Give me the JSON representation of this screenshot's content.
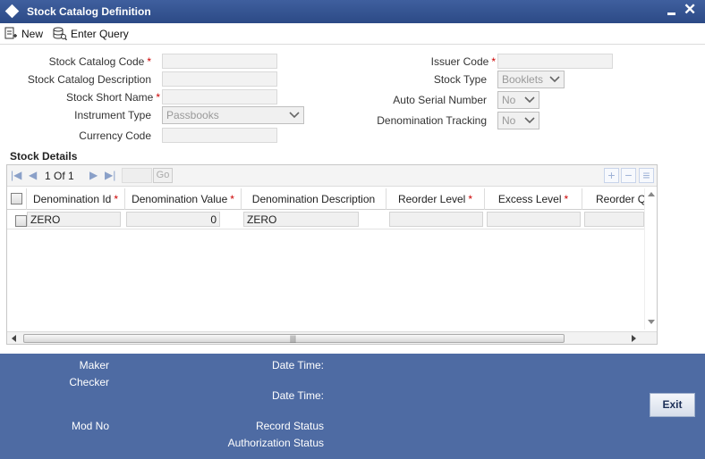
{
  "window": {
    "title": "Stock Catalog Definition"
  },
  "toolbar": {
    "new_label": "New",
    "enter_query_label": "Enter Query"
  },
  "form": {
    "stock_catalog_code_label": "Stock Catalog Code",
    "stock_catalog_description_label": "Stock Catalog Description",
    "stock_short_name_label": "Stock Short Name",
    "instrument_type_label": "Instrument Type",
    "instrument_type_value": "Passbooks",
    "currency_code_label": "Currency Code",
    "issuer_code_label": "Issuer Code",
    "stock_type_label": "Stock Type",
    "stock_type_value": "Booklets",
    "auto_serial_number_label": "Auto Serial Number",
    "auto_serial_number_value": "No",
    "denomination_tracking_label": "Denomination Tracking",
    "denomination_tracking_value": "No",
    "required_mark": "*"
  },
  "stock_details": {
    "title": "Stock Details",
    "pager": {
      "page_text": "1 Of 1",
      "go_label": "Go"
    },
    "columns": [
      {
        "label": "Denomination Id",
        "required": true
      },
      {
        "label": "Denomination Value",
        "required": true
      },
      {
        "label": "Denomination Description",
        "required": false
      },
      {
        "label": "Reorder Level",
        "required": true
      },
      {
        "label": "Excess Level",
        "required": true
      },
      {
        "label": "Reorder Q",
        "required": false
      }
    ],
    "rows": [
      {
        "denomination_id": "ZERO",
        "denomination_value": "0",
        "denomination_description": "ZERO",
        "reorder_level": "",
        "excess_level": "",
        "reorder_q": ""
      }
    ]
  },
  "footer": {
    "maker_label": "Maker",
    "checker_label": "Checker",
    "date_time_label_1": "Date Time:",
    "date_time_label_2": "Date Time:",
    "mod_no_label": "Mod No",
    "record_status_label": "Record Status",
    "authorization_status_label": "Authorization Status",
    "exit_label": "Exit"
  },
  "colors": {
    "titlebar": "#2c4a86",
    "footer": "#4e6ba3",
    "required": "#cc0000"
  }
}
